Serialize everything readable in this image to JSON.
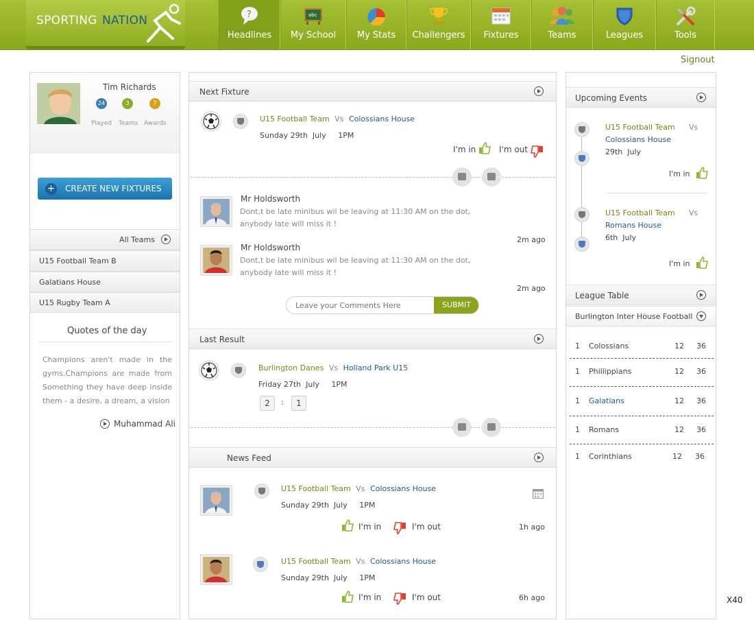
{
  "brand": {
    "part1": "SPORTING",
    "part2": "NATION"
  },
  "nav": [
    {
      "label": "Headlines",
      "icon": "speech-bubble-icon"
    },
    {
      "label": "My School",
      "icon": "chalkboard-icon"
    },
    {
      "label": "My Stats",
      "icon": "pie-chart-icon"
    },
    {
      "label": "Challengers",
      "icon": "trophy-icon"
    },
    {
      "label": "Fixtures",
      "icon": "calendar-icon"
    },
    {
      "label": "Teams",
      "icon": "people-icon"
    },
    {
      "label": "Leagues",
      "icon": "shield-icon"
    },
    {
      "label": "Tools",
      "icon": "tools-icon"
    }
  ],
  "signout": "Signout",
  "profile": {
    "name": "Tim Richards",
    "stats": [
      {
        "value": "24",
        "label": "Played",
        "color": "#3b82b0"
      },
      {
        "value": "3",
        "label": "Teams",
        "color": "#8bae28"
      },
      {
        "value": "7",
        "label": "Awards",
        "color": "#d7a21c"
      }
    ]
  },
  "create_button": "CREATE NEW FIXTURES",
  "all_teams": "All Teams",
  "teams": [
    "U15 Football Team B",
    "Galatians House",
    "U15 Rugby Team A"
  ],
  "quotes": {
    "title": "Quotes of the day",
    "text": "Champions aren't made in the gyms.Champions are made from Something they have deep inside them - a desire, a dream, a vision",
    "author": "Muhammad Ali"
  },
  "next_fixture": {
    "title": "Next Fixture",
    "home": "U15 Football Team",
    "vs": "Vs",
    "away": "Colossians House",
    "date": "Sunday 29th  July     1PM",
    "im_in": "I'm in",
    "im_out": "I'm out"
  },
  "comments": [
    {
      "author": "Mr Holdsworth",
      "line1": "Dont,t be late minibus wil be leaving at 11:30 AM on the dot,",
      "line2": "anybody late will miss it !",
      "time": "2m ago"
    },
    {
      "author": "Mr Holdsworth",
      "line1": "Dont,t be late minibus wil be leaving at 11:30 AM on the dot,",
      "line2": "anybody late will miss it !",
      "time": "2m ago"
    }
  ],
  "comment_input": {
    "placeholder": "Leave your Comments Here",
    "submit": "SUBMIT"
  },
  "last_result": {
    "title": "Last Result",
    "home": "Burlington Danes",
    "vs": "Vs",
    "away": "Holland Park U15",
    "date": "Friday 27th  July     1PM",
    "score_home": "2",
    "separator": ":",
    "score_away": "1"
  },
  "news_feed": {
    "title": "News Feed",
    "items": [
      {
        "home": "U15 Football Team",
        "vs": "Vs",
        "away": "Colossians House",
        "date": "Sunday 29th  July     1PM",
        "im_in": "I'm in",
        "im_out": "I'm out",
        "time": "1h ago"
      },
      {
        "home": "U15 Football Team",
        "vs": "Vs",
        "away": "Colossians House",
        "date": "Sunday 29th  July     1PM",
        "im_in": "I'm in",
        "im_out": "I'm out",
        "time": "6h ago"
      }
    ]
  },
  "upcoming": {
    "title": "Upcoming Events",
    "events": [
      {
        "home": "U15 Football Team",
        "vs": "Vs",
        "away": "Colossians House",
        "date": "29th  July",
        "im_in": "I'm in"
      },
      {
        "home": "U15 Football Team",
        "vs": "Vs",
        "away": "Romans House",
        "date": "6th  July",
        "im_in": "I'm in"
      }
    ]
  },
  "league": {
    "title": "League Table",
    "selected": "Burlington Inter House Football",
    "rows": [
      {
        "pos": "1",
        "team": "Colossians",
        "played": "12",
        "points": "36"
      },
      {
        "pos": "1",
        "team": "Phillippians",
        "played": "12",
        "points": "36"
      },
      {
        "pos": "1",
        "team": "Galatians",
        "played": "12",
        "points": "36"
      },
      {
        "pos": "1",
        "team": "Romans",
        "played": "12",
        "points": "36"
      },
      {
        "pos": "1",
        "team": "Corinthians",
        "played": "12",
        "points": "36"
      }
    ]
  },
  "corner_label": "X40"
}
